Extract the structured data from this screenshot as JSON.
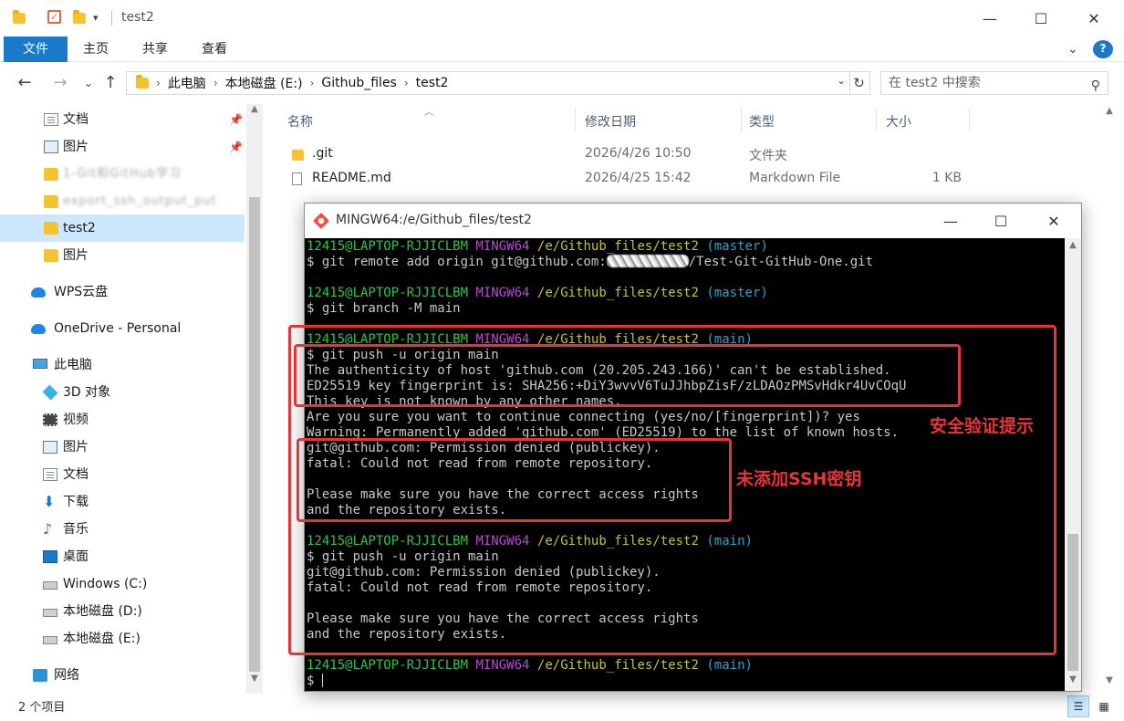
{
  "window": {
    "title": "test2",
    "minimize": "—",
    "maximize": "☐",
    "close": "✕",
    "quick_access_dropdown": "▾"
  },
  "ribbon": {
    "tabs": [
      "文件",
      "主页",
      "共享",
      "查看"
    ],
    "collapse": "⌄",
    "help": "?"
  },
  "address": {
    "back": "←",
    "forward": "→",
    "recent": "⌄",
    "up": "↑",
    "crumbs": [
      "此电脑",
      "本地磁盘 (E:)",
      "Github_files",
      "test2"
    ],
    "search_placeholder": "在 test2 中搜索"
  },
  "nav": {
    "items": [
      {
        "label": "文档",
        "icon": "document-icon"
      },
      {
        "label": "图片",
        "icon": "picture-icon"
      },
      {
        "label": "test2",
        "icon": "folder-icon"
      },
      {
        "label": "图片",
        "icon": "folder-icon"
      },
      {
        "label": "WPS云盘",
        "icon": "cloud-icon"
      },
      {
        "label": "OneDrive - Personal",
        "icon": "cloud-icon"
      },
      {
        "label": "此电脑",
        "icon": "computer-icon"
      },
      {
        "label": "3D 对象",
        "icon": "cube-icon"
      },
      {
        "label": "视频",
        "icon": "video-icon"
      },
      {
        "label": "图片",
        "icon": "picture-icon"
      },
      {
        "label": "文档",
        "icon": "document-icon"
      },
      {
        "label": "下载",
        "icon": "download-icon"
      },
      {
        "label": "音乐",
        "icon": "music-icon"
      },
      {
        "label": "桌面",
        "icon": "desktop-icon"
      },
      {
        "label": "Windows (C:)",
        "icon": "drive-icon"
      },
      {
        "label": "本地磁盘 (D:)",
        "icon": "drive-icon"
      },
      {
        "label": "本地磁盘 (E:)",
        "icon": "drive-icon"
      },
      {
        "label": "网络",
        "icon": "network-icon"
      }
    ],
    "blurred": [
      "1-Git和GitHub学习",
      "export_ssh_output_put"
    ]
  },
  "columns": {
    "name": "名称",
    "modified": "修改日期",
    "type": "类型",
    "size": "大小"
  },
  "files": [
    {
      "name": ".git",
      "modified": "2026/4/26 10:50",
      "type": "文件夹",
      "size": ""
    },
    {
      "name": "README.md",
      "modified": "2026/4/25 15:42",
      "type": "Markdown File",
      "size": "1 KB"
    }
  ],
  "status": {
    "count": "2 个项目"
  },
  "terminal": {
    "title": "MINGW64:/e/Github_files/test2",
    "lines": [
      {
        "kind": "prompt",
        "user": "12415@LAPTOP-RJJICLBM",
        "env": "MINGW64",
        "path": "/e/Github_files/test2",
        "branch": "(master)"
      },
      {
        "kind": "cmd_redacted",
        "pre": "$ git remote add origin git@github.com:",
        "post": "/Test-Git-GitHub-One.git"
      },
      {
        "kind": "blank"
      },
      {
        "kind": "prompt",
        "user": "12415@LAPTOP-RJJICLBM",
        "env": "MINGW64",
        "path": "/e/Github_files/test2",
        "branch": "(master)"
      },
      {
        "kind": "text",
        "text": "$ git branch -M main"
      },
      {
        "kind": "blank"
      },
      {
        "kind": "prompt",
        "user": "12415@LAPTOP-RJJICLBM",
        "env": "MINGW64",
        "path": "/e/Github_files/test2",
        "branch": "(main)"
      },
      {
        "kind": "text",
        "text": "$ git push -u origin main"
      },
      {
        "kind": "text",
        "text": "The authenticity of host 'github.com (20.205.243.166)' can't be established."
      },
      {
        "kind": "text",
        "text": "ED25519 key fingerprint is: SHA256:+DiY3wvvV6TuJJhbpZisF/zLDAOzPMSvHdkr4UvCOqU"
      },
      {
        "kind": "text",
        "text": "This key is not known by any other names."
      },
      {
        "kind": "text",
        "text": "Are you sure you want to continue connecting (yes/no/[fingerprint])? yes"
      },
      {
        "kind": "text",
        "text": "Warning: Permanently added 'github.com' (ED25519) to the list of known hosts."
      },
      {
        "kind": "text",
        "text": "git@github.com: Permission denied (publickey)."
      },
      {
        "kind": "text",
        "text": "fatal: Could not read from remote repository."
      },
      {
        "kind": "blank"
      },
      {
        "kind": "text",
        "text": "Please make sure you have the correct access rights"
      },
      {
        "kind": "text",
        "text": "and the repository exists."
      },
      {
        "kind": "blank"
      },
      {
        "kind": "prompt",
        "user": "12415@LAPTOP-RJJICLBM",
        "env": "MINGW64",
        "path": "/e/Github_files/test2",
        "branch": "(main)"
      },
      {
        "kind": "text",
        "text": "$ git push -u origin main"
      },
      {
        "kind": "text",
        "text": "git@github.com: Permission denied (publickey)."
      },
      {
        "kind": "text",
        "text": "fatal: Could not read from remote repository."
      },
      {
        "kind": "blank"
      },
      {
        "kind": "text",
        "text": "Please make sure you have the correct access rights"
      },
      {
        "kind": "text",
        "text": "and the repository exists."
      },
      {
        "kind": "blank"
      },
      {
        "kind": "prompt",
        "user": "12415@LAPTOP-RJJICLBM",
        "env": "MINGW64",
        "path": "/e/Github_files/test2",
        "branch": "(main)"
      },
      {
        "kind": "cursor",
        "text": "$ "
      }
    ]
  },
  "annotations": {
    "security_prompt": "安全验证提示",
    "no_ssh_key": "未添加SSH密钥"
  },
  "colors": {
    "accent": "#1979ca",
    "selected": "#cce8ff",
    "prompt_user": "#26c946",
    "prompt_env": "#b64bcd",
    "prompt_path": "#c7c41e",
    "prompt_branch": "#2aa3c9",
    "annotation": "#e8333a"
  }
}
